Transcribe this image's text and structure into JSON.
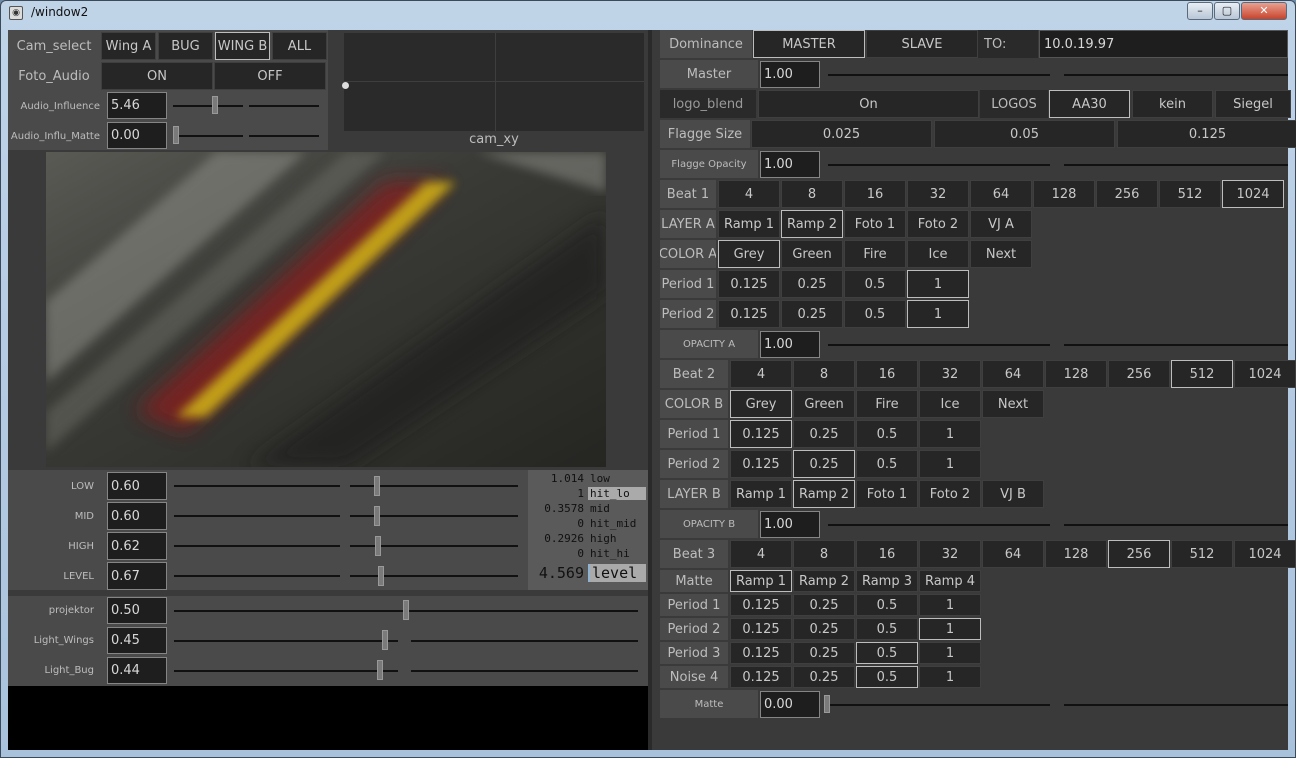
{
  "window": {
    "title": "/window2",
    "min": "–",
    "max": "▢",
    "close": "✕",
    "icon": "window-icon"
  },
  "left": {
    "cam_select": {
      "label": "Cam_select",
      "options": [
        "Wing A",
        "BUG",
        "WING B",
        "ALL"
      ],
      "selected": "WING B"
    },
    "foto_audio": {
      "label": "Foto_Audio",
      "on": "ON",
      "off": "OFF"
    },
    "audio_influence": {
      "label": "Audio_Influence",
      "value": "5.46",
      "level": 0.55
    },
    "audio_influ_matte": {
      "label": "Audio_Influ_Matte",
      "value": "0.00",
      "level": 0.0
    },
    "cam_xy": {
      "label": "cam_xy"
    },
    "bands": [
      {
        "label": "LOW",
        "value": "0.60",
        "level": 0.6
      },
      {
        "label": "MID",
        "value": "0.60",
        "level": 0.6
      },
      {
        "label": "HIGH",
        "value": "0.62",
        "level": 0.62
      },
      {
        "label": "LEVEL",
        "value": "0.67",
        "level": 0.67
      }
    ],
    "readout": [
      {
        "num": "1.014",
        "name": "low"
      },
      {
        "num": "1",
        "name": "hit_lo"
      },
      {
        "num": "0.3578",
        "name": "mid"
      },
      {
        "num": "0",
        "name": "hit_mid"
      },
      {
        "num": "0.2926",
        "name": "high"
      },
      {
        "num": "0",
        "name": "hit_hi"
      },
      {
        "num": "4.569",
        "name": "level"
      }
    ],
    "lights": [
      {
        "label": "projektor",
        "value": "0.50",
        "level": 0.5
      },
      {
        "label": "Light_Wings",
        "value": "0.45",
        "level": 0.45
      },
      {
        "label": "Light_Bug",
        "value": "0.44",
        "level": 0.44
      }
    ]
  },
  "right": {
    "dominance": {
      "label": "Dominance",
      "master": "MASTER",
      "slave": "SLAVE",
      "to_label": "TO:",
      "to_value": "10.0.19.97"
    },
    "master": {
      "label": "Master",
      "value": "1.00",
      "level": 1.0
    },
    "logo_blend": {
      "label": "logo_blend",
      "on": "On",
      "logos_label": "LOGOS",
      "logos": [
        "AA30",
        "kein",
        "Siegel"
      ],
      "selected": "AA30"
    },
    "flagge_size": {
      "label": "Flagge Size",
      "values": [
        "0.025",
        "0.05",
        "0.125"
      ]
    },
    "flagge_opacity": {
      "label": "Flagge Opacity",
      "value": "1.00",
      "level": 1.0
    },
    "beats": [
      "4",
      "8",
      "16",
      "32",
      "64",
      "128",
      "256",
      "512",
      "1024"
    ],
    "beat1": {
      "label": "Beat 1",
      "selected": "1024"
    },
    "layer_a": {
      "label": "LAYER A",
      "items": [
        "Ramp 1",
        "Ramp 2",
        "Foto 1",
        "Foto 2",
        "VJ A"
      ],
      "selected": "Ramp 2"
    },
    "color_a": {
      "label": "COLOR A",
      "items": [
        "Grey",
        "Green",
        "Fire",
        "Ice",
        "Next"
      ],
      "selected": "Grey"
    },
    "periods": [
      "0.125",
      "0.25",
      "0.5",
      "1"
    ],
    "period1a": {
      "label": "Period 1",
      "selected": "1"
    },
    "period2a": {
      "label": "Period 2",
      "selected": "1"
    },
    "opacity_a": {
      "label": "OPACITY A",
      "value": "1.00",
      "level": 1.0
    },
    "beat2": {
      "label": "Beat 2",
      "selected": "512"
    },
    "color_b": {
      "label": "COLOR B",
      "items": [
        "Grey",
        "Green",
        "Fire",
        "Ice",
        "Next"
      ],
      "selected": "Grey"
    },
    "period1b": {
      "label": "Period 1",
      "selected": "0.125"
    },
    "period2b": {
      "label": "Period 2",
      "selected": "0.25"
    },
    "layer_b": {
      "label": "LAYER B",
      "items": [
        "Ramp 1",
        "Ramp 2",
        "Foto 1",
        "Foto 2",
        "VJ B"
      ],
      "selected": "Ramp 2"
    },
    "opacity_b": {
      "label": "OPACITY B",
      "value": "1.00",
      "level": 1.0
    },
    "beat3": {
      "label": "Beat 3",
      "selected": "256"
    },
    "matte": {
      "label": "Matte",
      "items": [
        "Ramp 1",
        "Ramp 2",
        "Ramp 3",
        "Ramp 4"
      ],
      "selected": "Ramp 1"
    },
    "matte_rows": [
      {
        "label": "Period 1",
        "selected": "none"
      },
      {
        "label": "Period 2",
        "selected": "1"
      },
      {
        "label": "Period 3",
        "selected": "0.5"
      },
      {
        "label": "Noise 4",
        "selected": "0.5"
      }
    ],
    "matte_slider": {
      "label": "Matte",
      "value": "0.00",
      "level": 0.0
    }
  }
}
